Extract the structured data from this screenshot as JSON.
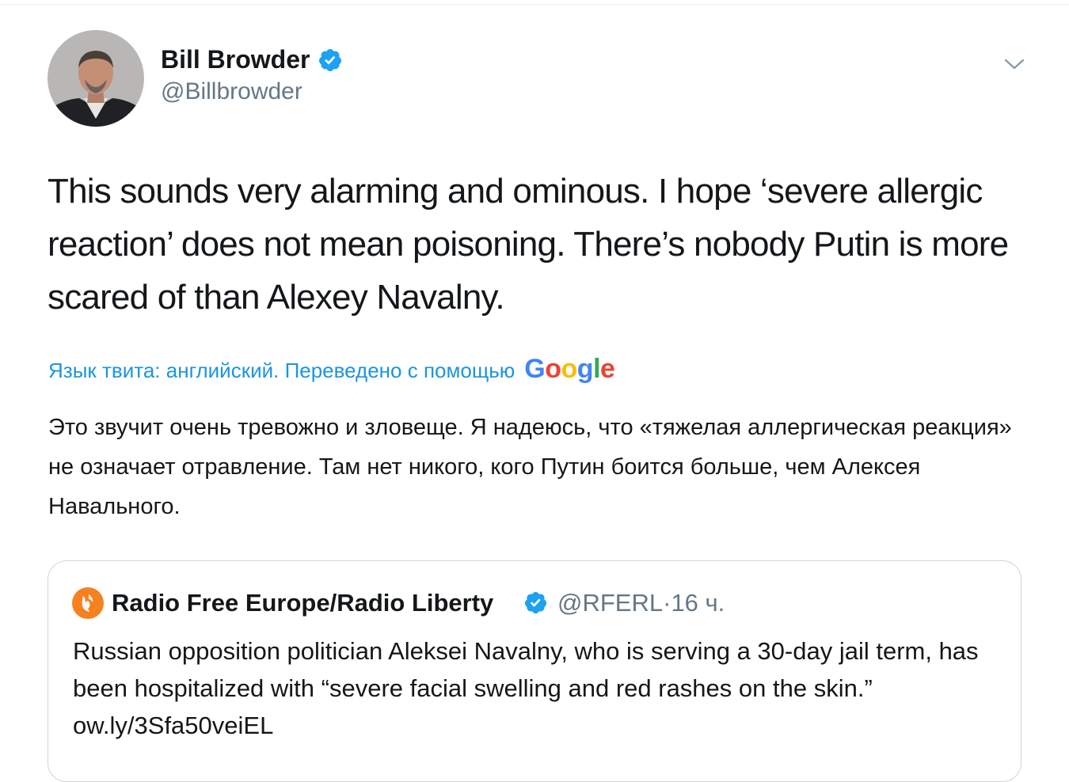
{
  "author": {
    "name": "Bill Browder",
    "handle": "@Billbrowder",
    "verified": true,
    "avatar": "avatar-photo"
  },
  "menu": {
    "icon": "chevron-down-icon"
  },
  "tweet": {
    "text": "This sounds very alarming and ominous. I hope ‘severe allergic reaction’ does not mean poisoning. There’s nobody Putin is more scared of than Alexey Navalny."
  },
  "translation": {
    "note": "Язык твита: английский. Переведено с помощью",
    "provider": "Google",
    "text": "Это звучит очень тревожно и зловеще. Я надеюсь, что «тяжелая аллергическая реакция» не означает отравление. Там нет никого, кого Путин боится больше, чем Алексея Навального."
  },
  "quote": {
    "name": "Radio Free Europe/Radio Liberty",
    "handle": "@RFERL",
    "separator": "·",
    "time": "16 ч.",
    "verified": true,
    "logo_icon": "rferl-torch-icon",
    "text": "Russian opposition politician Aleksei Navalny, who is serving a 30-day jail term, has been hospitalized with “severe facial swelling and red rashes on the skin.” ow.ly/3Sfa50veiEL"
  },
  "colors": {
    "verified_blue": "#1da1f2",
    "link_blue": "#1b95e0",
    "secondary_text": "#657786",
    "primary_text": "#14171a",
    "rferl_orange": "#f5821f",
    "card_border": "#ccd6dd"
  }
}
